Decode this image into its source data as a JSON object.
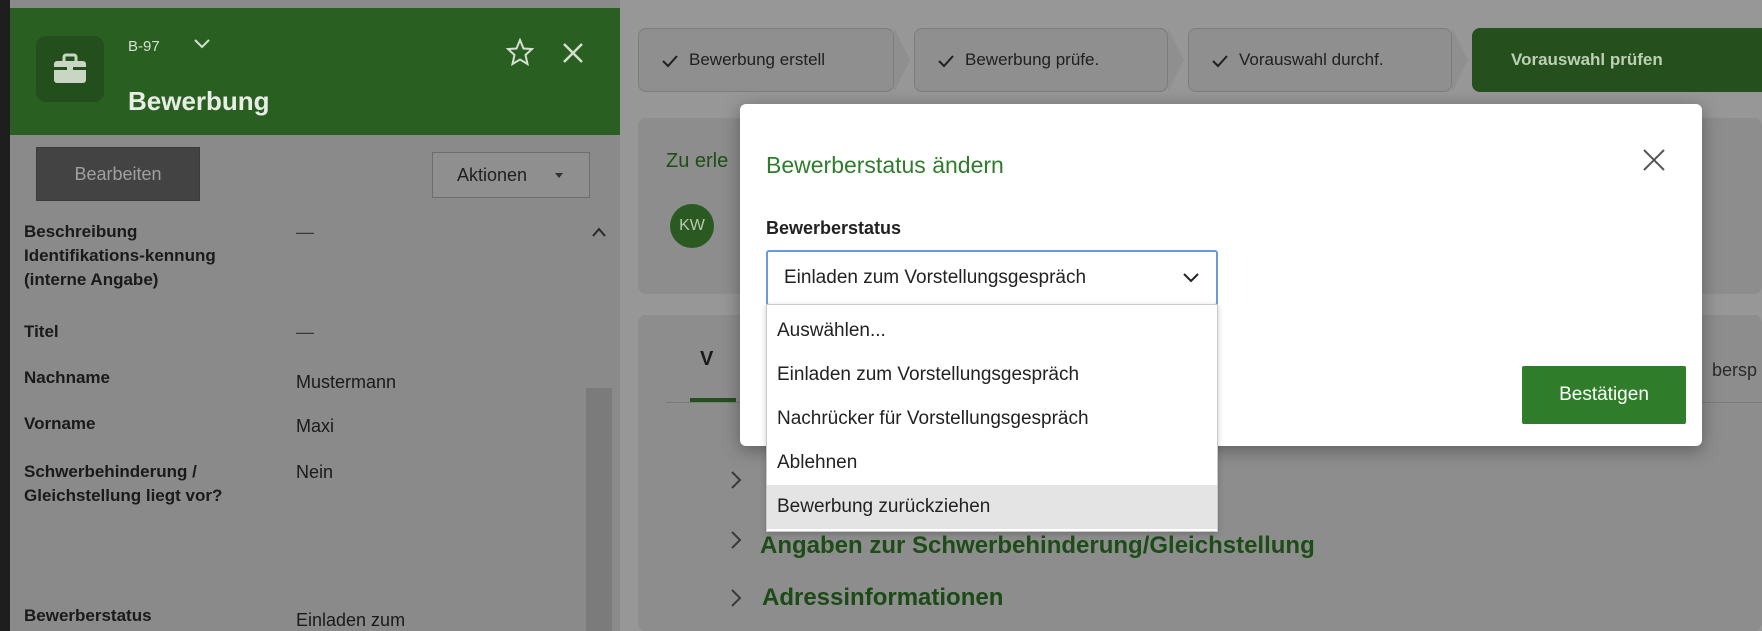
{
  "header": {
    "record_id": "B-97",
    "record_type": "Bewerbung"
  },
  "toolbar": {
    "edit_label": "Bearbeiten",
    "actions_label": "Aktionen"
  },
  "fields": [
    {
      "label": "Beschreibung Identifikations-kennung (interne Angabe)",
      "value": "—"
    },
    {
      "label": "Titel",
      "value": "—"
    },
    {
      "label": "Nachname",
      "value": "Mustermann"
    },
    {
      "label": "Vorname",
      "value": "Maxi"
    },
    {
      "label": "Schwerbehinderung / Gleichstellung liegt vor?",
      "value": "Nein"
    },
    {
      "label": "Bewerberstatus",
      "value": "Einladen zum"
    }
  ],
  "steps": [
    {
      "label": "Bewerbung erstell",
      "done": true
    },
    {
      "label": "Bewerbung prüfe.",
      "done": true
    },
    {
      "label": "Vorauswahl durchf.",
      "done": true
    },
    {
      "label": "Vorauswahl prüfen",
      "done": false
    }
  ],
  "tasks": {
    "title": "Zu erle",
    "avatar": "KW"
  },
  "content": {
    "tab_label": "V",
    "tab_right_label": "bersp",
    "sections": [
      "Angaben zur Schwerbehinderung/Gleichstellung",
      "Adressinformationen"
    ]
  },
  "modal": {
    "title": "Bewerberstatus ändern",
    "field_label": "Bewerberstatus",
    "selected_value": "Einladen zum Vorstellungsgespräch",
    "confirm_label": "Bestätigen",
    "options": [
      "Auswählen...",
      "Einladen zum Vorstellungsgespräch",
      "Nachrücker für Vorstellungsgespräch",
      "Ablehnen",
      "Bewerbung zurückziehen"
    ],
    "hovered_option": "Bewerbung zurückziehen"
  },
  "colors": {
    "brand_green": "#2f7d2b",
    "header_green": "#2a5f22",
    "select_focus": "#6a9bd6"
  }
}
